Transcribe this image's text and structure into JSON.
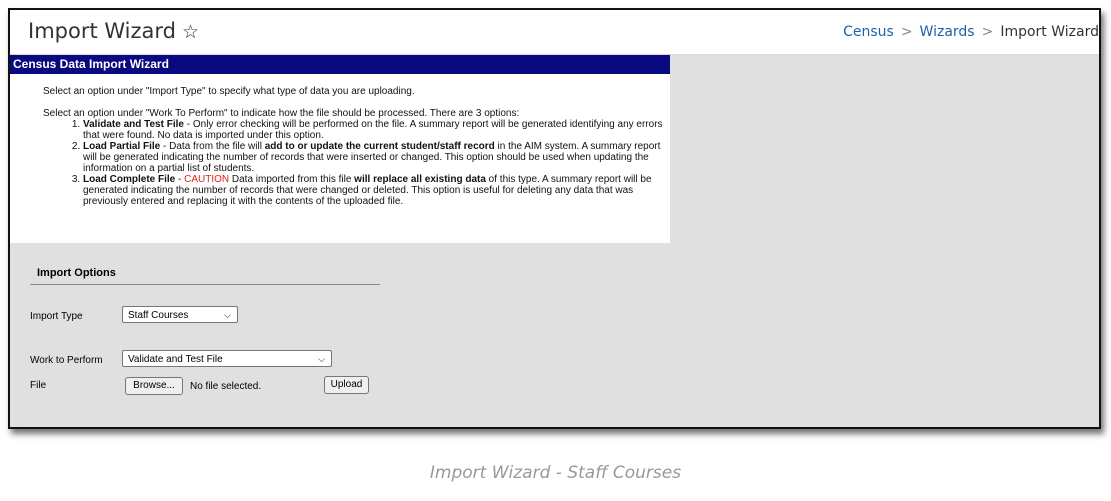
{
  "header": {
    "title": "Import Wizard",
    "breadcrumbs": [
      "Census",
      "Wizards",
      "Import Wizard"
    ]
  },
  "panel": {
    "heading": "Census Data Import Wizard",
    "intro1": "Select an option under \"Import Type\" to specify what type of data you are uploading.",
    "intro2": "Select an option under \"Work To Perform\" to indicate how the file should be processed. There are 3 options:",
    "options": [
      {
        "name": "Validate and Test File",
        "text": " - Only error checking will be performed on the file. A summary report will be generated identifying any errors that were found. No data is imported under this option."
      },
      {
        "name": "Load Partial File",
        "pre": " - Data from the file will ",
        "bold": "add to or update the current student/staff record",
        "post": " in the AIM system. A summary report will be generated indicating the number of records that were inserted or changed. This option should be used when updating the information on a partial list of students."
      },
      {
        "name": "Load Complete File",
        "dash": " - ",
        "caution": "CAUTION",
        "pre": " Data imported from this file ",
        "bold": "will replace all existing data",
        "post": " of this type. A summary report will be generated indicating the number of records that were changed or deleted. This option is useful for deleting any data that was previously entered and replacing it with the contents of the uploaded file."
      }
    ]
  },
  "import_options": {
    "title": "Import Options",
    "import_type_label": "Import Type",
    "import_type_value": "Staff Courses",
    "work_label": "Work to Perform",
    "work_value": "Validate and Test File",
    "file_label": "File",
    "browse_label": "Browse...",
    "file_status": "No file selected.",
    "upload_label": "Upload"
  },
  "caption": "Import Wizard - Staff Courses",
  "colors": {
    "panel_header": "#0a0a80",
    "link": "#1d62a8",
    "caution": "#e0201b",
    "background_gray": "#e0e0e0"
  }
}
